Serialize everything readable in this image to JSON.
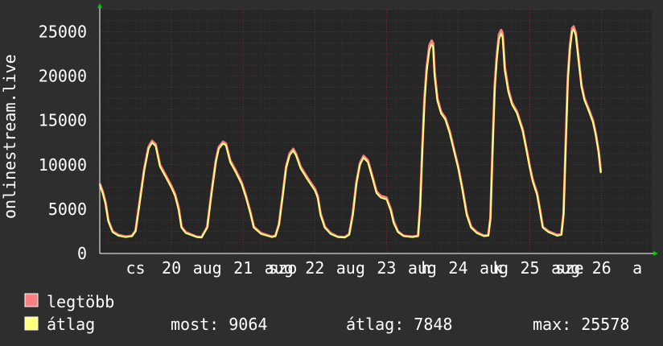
{
  "chart_data": {
    "type": "line",
    "ylabel": "onlinestream.live",
    "ylim": [
      0,
      27500
    ],
    "yticks": [
      0,
      5000,
      10000,
      15000,
      20000,
      25000
    ],
    "x_ticks": [
      {
        "pos": 0.5,
        "label": "cs"
      },
      {
        "pos": 1.0,
        "label": "20"
      },
      {
        "pos": 1.5,
        "label": "aug"
      },
      {
        "pos": 2.0,
        "label": "21"
      },
      {
        "pos": 2.5,
        "label": "aug"
      },
      {
        "pos": 2.55,
        "label": "szo"
      },
      {
        "pos": 3.0,
        "label": "22"
      },
      {
        "pos": 3.5,
        "label": "aug"
      },
      {
        "pos": 4.0,
        "label": "23"
      },
      {
        "pos": 4.5,
        "label": "aug"
      },
      {
        "pos": 4.55,
        "label": "h"
      },
      {
        "pos": 5.0,
        "label": "24"
      },
      {
        "pos": 5.5,
        "label": "aug"
      },
      {
        "pos": 5.55,
        "label": "k"
      },
      {
        "pos": 6.0,
        "label": "25"
      },
      {
        "pos": 6.5,
        "label": "aug"
      },
      {
        "pos": 6.55,
        "label": "sze"
      },
      {
        "pos": 7.0,
        "label": "26"
      },
      {
        "pos": 7.5,
        "label": "a"
      }
    ],
    "xlim": [
      0,
      7.7
    ],
    "series": [
      {
        "name": "legtöbb",
        "color": "#ff7f7f",
        "points": [
          [
            0,
            7900
          ],
          [
            0.04,
            7000
          ],
          [
            0.08,
            5800
          ],
          [
            0.12,
            3700
          ],
          [
            0.18,
            2500
          ],
          [
            0.26,
            2100
          ],
          [
            0.36,
            1900
          ],
          [
            0.45,
            2000
          ],
          [
            0.5,
            2600
          ],
          [
            0.55,
            5500
          ],
          [
            0.62,
            9500
          ],
          [
            0.68,
            12000
          ],
          [
            0.73,
            12700
          ],
          [
            0.78,
            12300
          ],
          [
            0.84,
            10000
          ],
          [
            0.92,
            8800
          ],
          [
            1.0,
            7600
          ],
          [
            1.05,
            6700
          ],
          [
            1.1,
            5200
          ],
          [
            1.14,
            3000
          ],
          [
            1.2,
            2400
          ],
          [
            1.35,
            1900
          ],
          [
            1.42,
            1850
          ],
          [
            1.5,
            3000
          ],
          [
            1.56,
            7000
          ],
          [
            1.62,
            10500
          ],
          [
            1.66,
            12000
          ],
          [
            1.72,
            12600
          ],
          [
            1.76,
            12400
          ],
          [
            1.82,
            10500
          ],
          [
            1.9,
            9300
          ],
          [
            1.98,
            8000
          ],
          [
            2.04,
            6500
          ],
          [
            2.1,
            4700
          ],
          [
            2.15,
            3000
          ],
          [
            2.25,
            2300
          ],
          [
            2.4,
            1900
          ],
          [
            2.45,
            2000
          ],
          [
            2.5,
            3300
          ],
          [
            2.55,
            6500
          ],
          [
            2.6,
            9800
          ],
          [
            2.65,
            11300
          ],
          [
            2.7,
            11800
          ],
          [
            2.74,
            11200
          ],
          [
            2.8,
            9800
          ],
          [
            2.9,
            8500
          ],
          [
            3.0,
            7300
          ],
          [
            3.04,
            6500
          ],
          [
            3.08,
            4500
          ],
          [
            3.14,
            3000
          ],
          [
            3.22,
            2300
          ],
          [
            3.32,
            1900
          ],
          [
            3.42,
            1850
          ],
          [
            3.48,
            2200
          ],
          [
            3.53,
            4500
          ],
          [
            3.58,
            8000
          ],
          [
            3.63,
            10200
          ],
          [
            3.68,
            11000
          ],
          [
            3.74,
            10500
          ],
          [
            3.8,
            8800
          ],
          [
            3.86,
            7000
          ],
          [
            3.92,
            6500
          ],
          [
            4.0,
            6300
          ],
          [
            4.06,
            5000
          ],
          [
            4.1,
            3600
          ],
          [
            4.16,
            2500
          ],
          [
            4.24,
            2000
          ],
          [
            4.36,
            1900
          ],
          [
            4.44,
            2000
          ],
          [
            4.47,
            5500
          ],
          [
            4.5,
            12000
          ],
          [
            4.53,
            17500
          ],
          [
            4.56,
            21000
          ],
          [
            4.6,
            23500
          ],
          [
            4.63,
            24000
          ],
          [
            4.65,
            23700
          ],
          [
            4.67,
            20500
          ],
          [
            4.71,
            17500
          ],
          [
            4.76,
            16000
          ],
          [
            4.82,
            15300
          ],
          [
            4.88,
            13800
          ],
          [
            4.94,
            11800
          ],
          [
            5.0,
            9800
          ],
          [
            5.06,
            7300
          ],
          [
            5.12,
            4500
          ],
          [
            5.18,
            3000
          ],
          [
            5.26,
            2400
          ],
          [
            5.36,
            2000
          ],
          [
            5.42,
            2100
          ],
          [
            5.45,
            4000
          ],
          [
            5.48,
            12000
          ],
          [
            5.51,
            19000
          ],
          [
            5.54,
            22500
          ],
          [
            5.57,
            24700
          ],
          [
            5.6,
            25200
          ],
          [
            5.62,
            24800
          ],
          [
            5.65,
            21000
          ],
          [
            5.7,
            18500
          ],
          [
            5.75,
            17000
          ],
          [
            5.82,
            16000
          ],
          [
            5.9,
            14000
          ],
          [
            5.96,
            11500
          ],
          [
            6.0,
            9800
          ],
          [
            6.04,
            8300
          ],
          [
            6.1,
            6800
          ],
          [
            6.14,
            5000
          ],
          [
            6.18,
            3000
          ],
          [
            6.26,
            2500
          ],
          [
            6.38,
            2100
          ],
          [
            6.44,
            2200
          ],
          [
            6.47,
            4500
          ],
          [
            6.5,
            12500
          ],
          [
            6.53,
            20000
          ],
          [
            6.56,
            23500
          ],
          [
            6.59,
            25400
          ],
          [
            6.61,
            25600
          ],
          [
            6.64,
            24900
          ],
          [
            6.68,
            22000
          ],
          [
            6.72,
            19000
          ],
          [
            6.76,
            17500
          ],
          [
            6.82,
            16300
          ],
          [
            6.88,
            15000
          ],
          [
            6.92,
            13500
          ],
          [
            6.96,
            11500
          ],
          [
            6.99,
            9200
          ]
        ]
      },
      {
        "name": "átlag",
        "color": "#ffff7f",
        "points": [
          [
            0,
            7700
          ],
          [
            0.04,
            6800
          ],
          [
            0.08,
            5600
          ],
          [
            0.12,
            3600
          ],
          [
            0.18,
            2400
          ],
          [
            0.26,
            2000
          ],
          [
            0.36,
            1850
          ],
          [
            0.45,
            1950
          ],
          [
            0.5,
            2500
          ],
          [
            0.55,
            5300
          ],
          [
            0.62,
            9300
          ],
          [
            0.68,
            11800
          ],
          [
            0.73,
            12500
          ],
          [
            0.78,
            12100
          ],
          [
            0.84,
            9800
          ],
          [
            0.92,
            8600
          ],
          [
            1.0,
            7400
          ],
          [
            1.05,
            6500
          ],
          [
            1.1,
            4900
          ],
          [
            1.14,
            2900
          ],
          [
            1.2,
            2300
          ],
          [
            1.35,
            1850
          ],
          [
            1.42,
            1800
          ],
          [
            1.5,
            2900
          ],
          [
            1.56,
            6800
          ],
          [
            1.62,
            10300
          ],
          [
            1.66,
            11800
          ],
          [
            1.72,
            12400
          ],
          [
            1.76,
            12200
          ],
          [
            1.82,
            10300
          ],
          [
            1.9,
            9100
          ],
          [
            1.98,
            7800
          ],
          [
            2.04,
            6300
          ],
          [
            2.1,
            4500
          ],
          [
            2.15,
            2900
          ],
          [
            2.25,
            2200
          ],
          [
            2.4,
            1850
          ],
          [
            2.45,
            1950
          ],
          [
            2.5,
            3200
          ],
          [
            2.55,
            6300
          ],
          [
            2.6,
            9600
          ],
          [
            2.65,
            11100
          ],
          [
            2.7,
            11600
          ],
          [
            2.74,
            11000
          ],
          [
            2.8,
            9600
          ],
          [
            2.9,
            8300
          ],
          [
            3.0,
            7100
          ],
          [
            3.04,
            6300
          ],
          [
            3.08,
            4300
          ],
          [
            3.14,
            2900
          ],
          [
            3.22,
            2200
          ],
          [
            3.32,
            1850
          ],
          [
            3.42,
            1800
          ],
          [
            3.48,
            2100
          ],
          [
            3.53,
            4300
          ],
          [
            3.58,
            7800
          ],
          [
            3.63,
            10000
          ],
          [
            3.68,
            10800
          ],
          [
            3.74,
            10300
          ],
          [
            3.8,
            8600
          ],
          [
            3.86,
            6800
          ],
          [
            3.92,
            6300
          ],
          [
            4.0,
            6100
          ],
          [
            4.06,
            4800
          ],
          [
            4.1,
            3400
          ],
          [
            4.16,
            2400
          ],
          [
            4.24,
            1950
          ],
          [
            4.36,
            1850
          ],
          [
            4.44,
            1950
          ],
          [
            4.47,
            5200
          ],
          [
            4.5,
            11500
          ],
          [
            4.53,
            17000
          ],
          [
            4.56,
            20500
          ],
          [
            4.6,
            23000
          ],
          [
            4.63,
            23600
          ],
          [
            4.65,
            23300
          ],
          [
            4.67,
            20000
          ],
          [
            4.71,
            17200
          ],
          [
            4.76,
            15800
          ],
          [
            4.82,
            15100
          ],
          [
            4.88,
            13600
          ],
          [
            4.94,
            11600
          ],
          [
            5.0,
            9600
          ],
          [
            5.06,
            7100
          ],
          [
            5.12,
            4300
          ],
          [
            5.18,
            2900
          ],
          [
            5.26,
            2300
          ],
          [
            5.36,
            1950
          ],
          [
            5.42,
            2000
          ],
          [
            5.45,
            3800
          ],
          [
            5.48,
            11500
          ],
          [
            5.51,
            18500
          ],
          [
            5.54,
            22000
          ],
          [
            5.57,
            24200
          ],
          [
            5.6,
            24800
          ],
          [
            5.62,
            24400
          ],
          [
            5.65,
            20600
          ],
          [
            5.7,
            18200
          ],
          [
            5.75,
            16800
          ],
          [
            5.82,
            15800
          ],
          [
            5.9,
            13800
          ],
          [
            5.96,
            11300
          ],
          [
            6.0,
            9600
          ],
          [
            6.04,
            8100
          ],
          [
            6.1,
            6600
          ],
          [
            6.14,
            4800
          ],
          [
            6.18,
            2900
          ],
          [
            6.26,
            2400
          ],
          [
            6.38,
            2000
          ],
          [
            6.44,
            2100
          ],
          [
            6.47,
            4300
          ],
          [
            6.5,
            12000
          ],
          [
            6.53,
            19500
          ],
          [
            6.56,
            23000
          ],
          [
            6.59,
            25000
          ],
          [
            6.61,
            25300
          ],
          [
            6.64,
            24600
          ],
          [
            6.68,
            21700
          ],
          [
            6.72,
            18800
          ],
          [
            6.76,
            17300
          ],
          [
            6.82,
            16100
          ],
          [
            6.88,
            14800
          ],
          [
            6.92,
            13300
          ],
          [
            6.96,
            11300
          ],
          [
            6.99,
            9064
          ]
        ]
      }
    ]
  },
  "legend": {
    "max_label": "legtöbb",
    "avg_label": "átlag",
    "max_color": "#ff7f7f",
    "avg_color": "#ffff7f"
  },
  "stats": {
    "current": "most: 9064",
    "average": "átlag: 7848",
    "maximum": "max: 25578"
  }
}
